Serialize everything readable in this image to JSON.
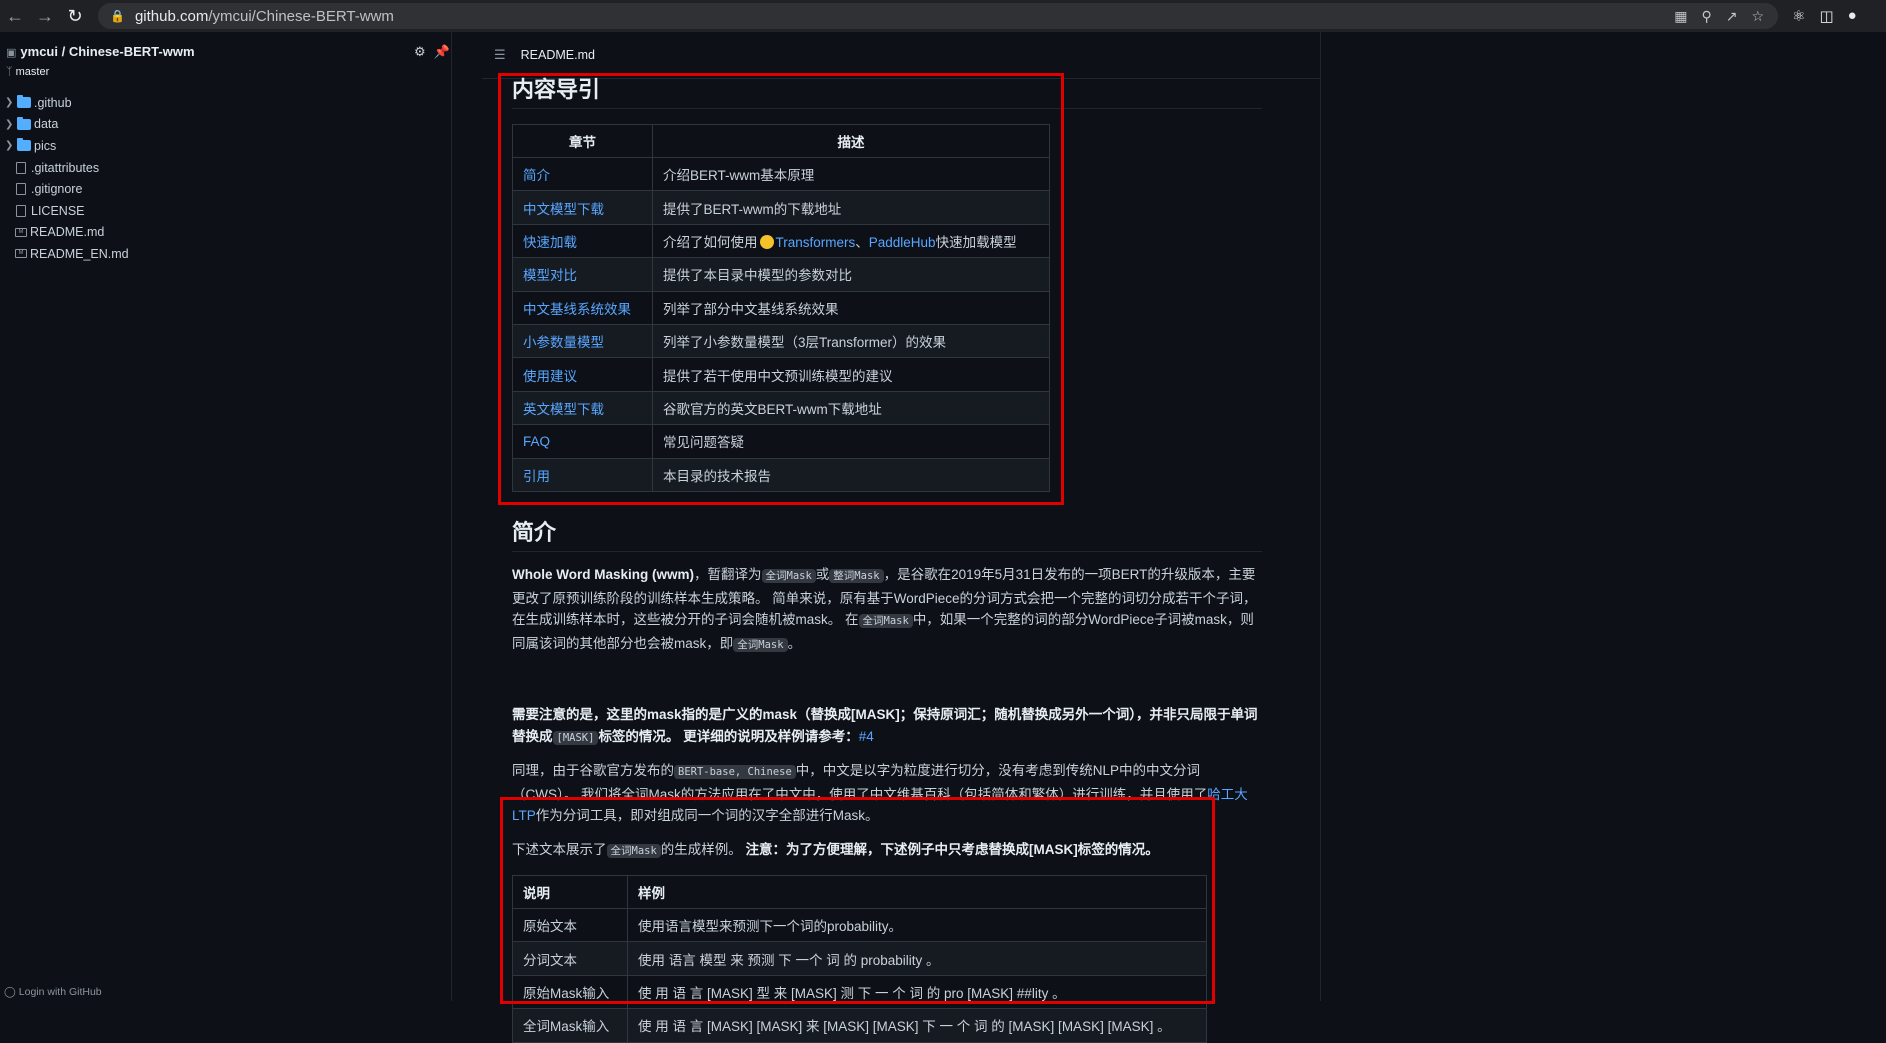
{
  "browser": {
    "url_host": "github.com",
    "url_path": "/ymcui/Chinese-BERT-wwm"
  },
  "sidebar": {
    "repo": "ymcui / Chinese-BERT-wwm",
    "branch": "master",
    "items": [
      {
        "label": ".github",
        "kind": "folder"
      },
      {
        "label": "data",
        "kind": "folder"
      },
      {
        "label": "pics",
        "kind": "folder"
      },
      {
        "label": ".gitattributes",
        "kind": "file"
      },
      {
        "label": ".gitignore",
        "kind": "file"
      },
      {
        "label": "LICENSE",
        "kind": "file"
      },
      {
        "label": "README.md",
        "kind": "md"
      },
      {
        "label": "README_EN.md",
        "kind": "md"
      }
    ],
    "login": "Login with GitHub"
  },
  "file_header": {
    "name": "README.md"
  },
  "toc": {
    "heading": "内容导引",
    "col_section": "章节",
    "col_desc": "描述",
    "rows": [
      {
        "section": "简介",
        "desc": "介绍BERT-wwm基本原理"
      },
      {
        "section": "中文模型下载",
        "desc": "提供了BERT-wwm的下载地址"
      },
      {
        "section": "快速加载",
        "desc_prefix": "介绍了如何使用",
        "link1": "Transformers",
        "sep": "、",
        "link2": "PaddleHub",
        "desc_suffix": "快速加载模型"
      },
      {
        "section": "模型对比",
        "desc": "提供了本目录中模型的参数对比"
      },
      {
        "section": "中文基线系统效果",
        "desc": "列举了部分中文基线系统效果"
      },
      {
        "section": "小参数量模型",
        "desc": "列举了小参数量模型（3层Transformer）的效果"
      },
      {
        "section": "使用建议",
        "desc": "提供了若干使用中文预训练模型的建议"
      },
      {
        "section": "英文模型下载",
        "desc": "谷歌官方的英文BERT-wwm下载地址"
      },
      {
        "section": "FAQ",
        "desc": "常见问题答疑"
      },
      {
        "section": "引用",
        "desc": "本目录的技术报告"
      }
    ]
  },
  "intro": {
    "heading": "简介",
    "p1": {
      "bold": "Whole Word Masking (wwm)",
      "t1": "，暂翻译为",
      "code1": "全词Mask",
      "t2": "或",
      "code2": "整词Mask",
      "t3": "，是谷歌在2019年5月31日发布的一项BERT的升级版本，主要更改了原预训练阶段的训练样本生成策略。 简单来说，原有基于WordPiece的分词方式会把一个完整的词切分成若干个子词，在生成训练样本时，这些被分开的子词会随机被mask。 在",
      "code3": "全词Mask",
      "t4": "中，如果一个完整的词的部分WordPiece子词被mask，则同属该词的其他部分也会被mask，即",
      "code4": "全词Mask",
      "t5": "。"
    },
    "p2": {
      "b1": "需要注意的是，这里的mask指的是广义的mask（替换成[MASK]；保持原词汇；随机替换成另外一个词），并非只局限于单词替换成",
      "code": "[MASK]",
      "b2": "标签的情况。 更详细的说明及样例请参考：",
      "link": "#4"
    },
    "p3": {
      "t1": "同理，由于谷歌官方发布的",
      "code": "BERT-base, Chinese",
      "t2": "中，中文是以字为粒度进行切分，没有考虑到传统NLP中的中文分词（CWS）。 我们将全词Mask的方法应用在了中文中，使用了中文维基百科（包括简体和繁体）进行训练，并且使用了",
      "link": "哈工大LTP",
      "t3": "作为分词工具，即对组成同一个词的汉字全部进行Mask。"
    },
    "p4": {
      "t1": "下述文本展示了",
      "code": "全词Mask",
      "t2": "的生成样例。 ",
      "bold": "注意：为了方便理解，下述例子中只考虑替换成[MASK]标签的情况。"
    }
  },
  "examples": {
    "col_desc": "说明",
    "col_sample": "样例",
    "rows": [
      {
        "label": "原始文本",
        "value": "使用语言模型来预测下一个词的probability。"
      },
      {
        "label": "分词文本",
        "value": "使用 语言 模型 来 预测 下 一个 词 的 probability 。"
      },
      {
        "label": "原始Mask输入",
        "value": "使 用 语 言 [MASK] 型 来 [MASK] 测 下 一 个 词 的 pro [MASK] ##lity 。"
      },
      {
        "label": "全词Mask输入",
        "value": "使 用 语 言 [MASK] [MASK] 来 [MASK] [MASK] 下 一 个 词 的 [MASK] [MASK] [MASK] 。"
      }
    ]
  },
  "colors": {
    "link": "#58a6ff",
    "highlight_box": "#e00000",
    "background": "#0d1117"
  }
}
